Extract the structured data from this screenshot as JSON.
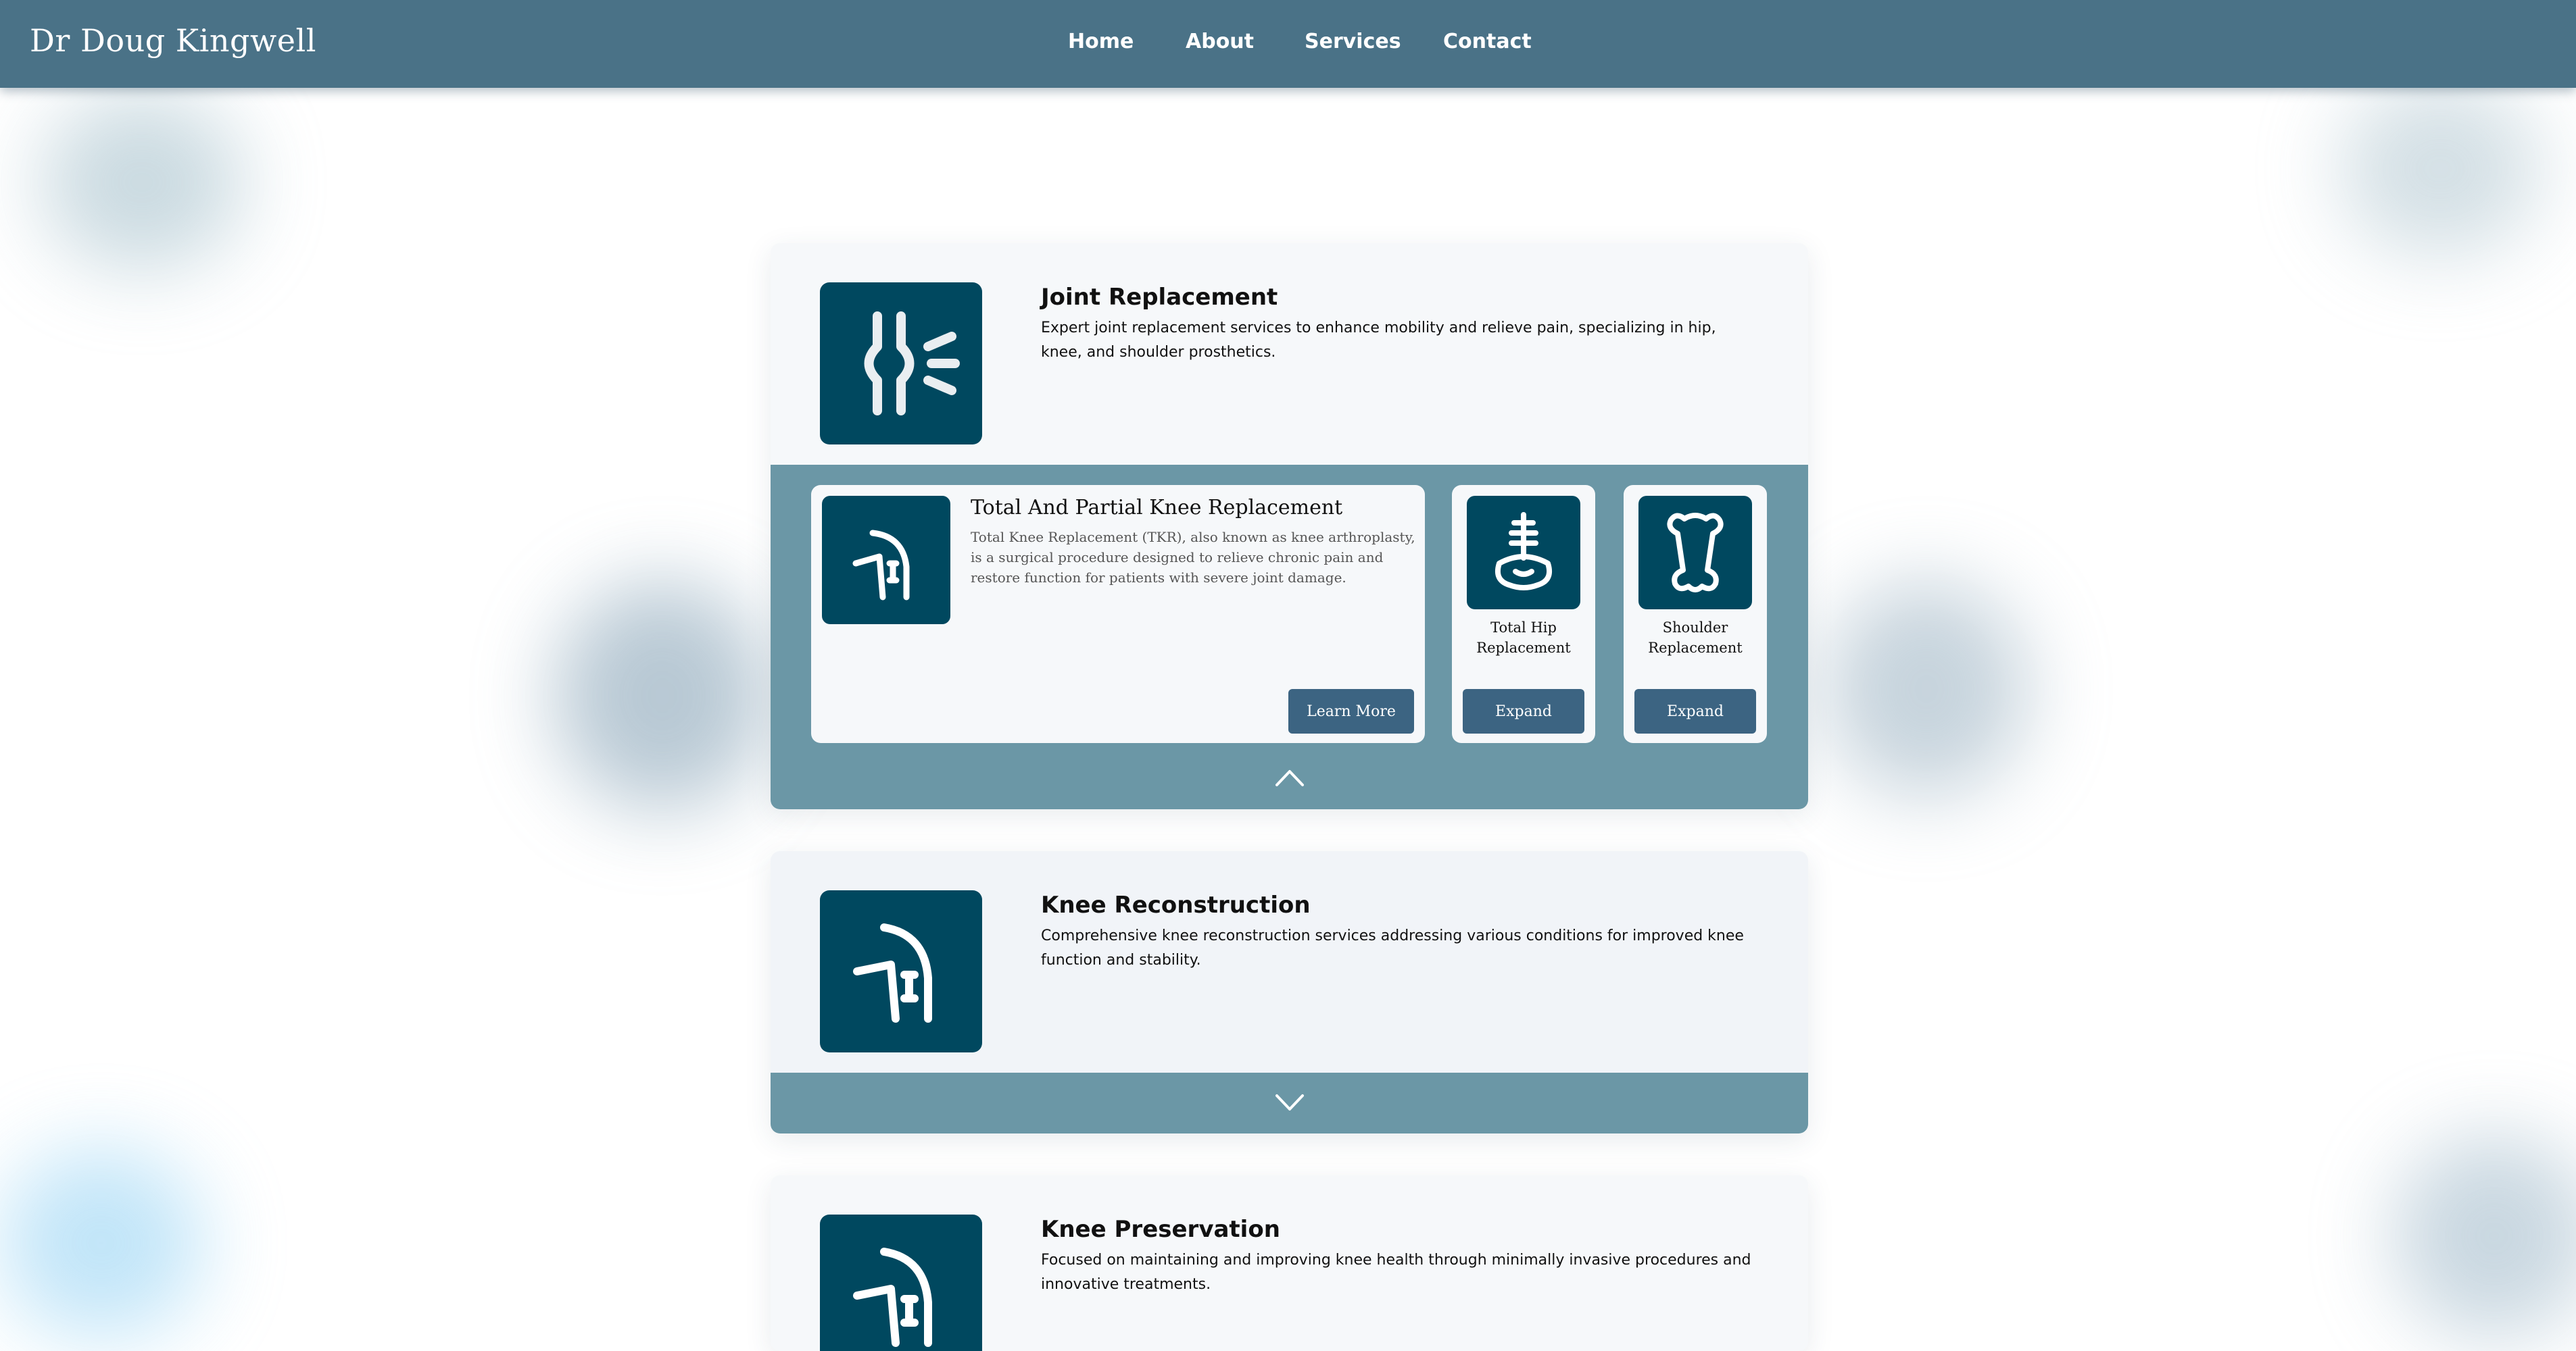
{
  "brand": {
    "name": "Dr Doug Kingwell"
  },
  "nav": {
    "items": [
      {
        "label": "Home"
      },
      {
        "label": "About"
      },
      {
        "label": "Services"
      },
      {
        "label": "Contact"
      }
    ]
  },
  "colors": {
    "header": "#4a7287",
    "icon_tile": "#00485f",
    "band": "#6b97a6",
    "button": "#3c6482"
  },
  "services": [
    {
      "title": "Joint Replacement",
      "description": "Expert joint replacement services to enhance mobility and relieve pain, specializing in hip, knee, and shoulder prosthetics.",
      "icon": "joint-icon",
      "expanded": true,
      "featured": {
        "title": "Total And Partial Knee Replacement",
        "description": "Total Knee Replacement (TKR), also known as knee arthroplasty, is a surgical procedure designed to relieve chronic pain and restore function for patients with severe joint damage.",
        "icon": "knee-icon",
        "button": "Learn More"
      },
      "others": [
        {
          "label": "Total Hip Replacement",
          "icon": "hip-icon",
          "button": "Expand"
        },
        {
          "label": "Shoulder Replacement",
          "icon": "bone-icon",
          "button": "Expand"
        }
      ]
    },
    {
      "title": "Knee Reconstruction",
      "description": "Comprehensive knee reconstruction services addressing various conditions for improved knee function and stability.",
      "icon": "knee-icon",
      "expanded": false
    },
    {
      "title": "Knee Preservation",
      "description": "Focused on maintaining and improving knee health through minimally invasive procedures and innovative treatments.",
      "icon": "knee-icon",
      "expanded": false
    }
  ]
}
